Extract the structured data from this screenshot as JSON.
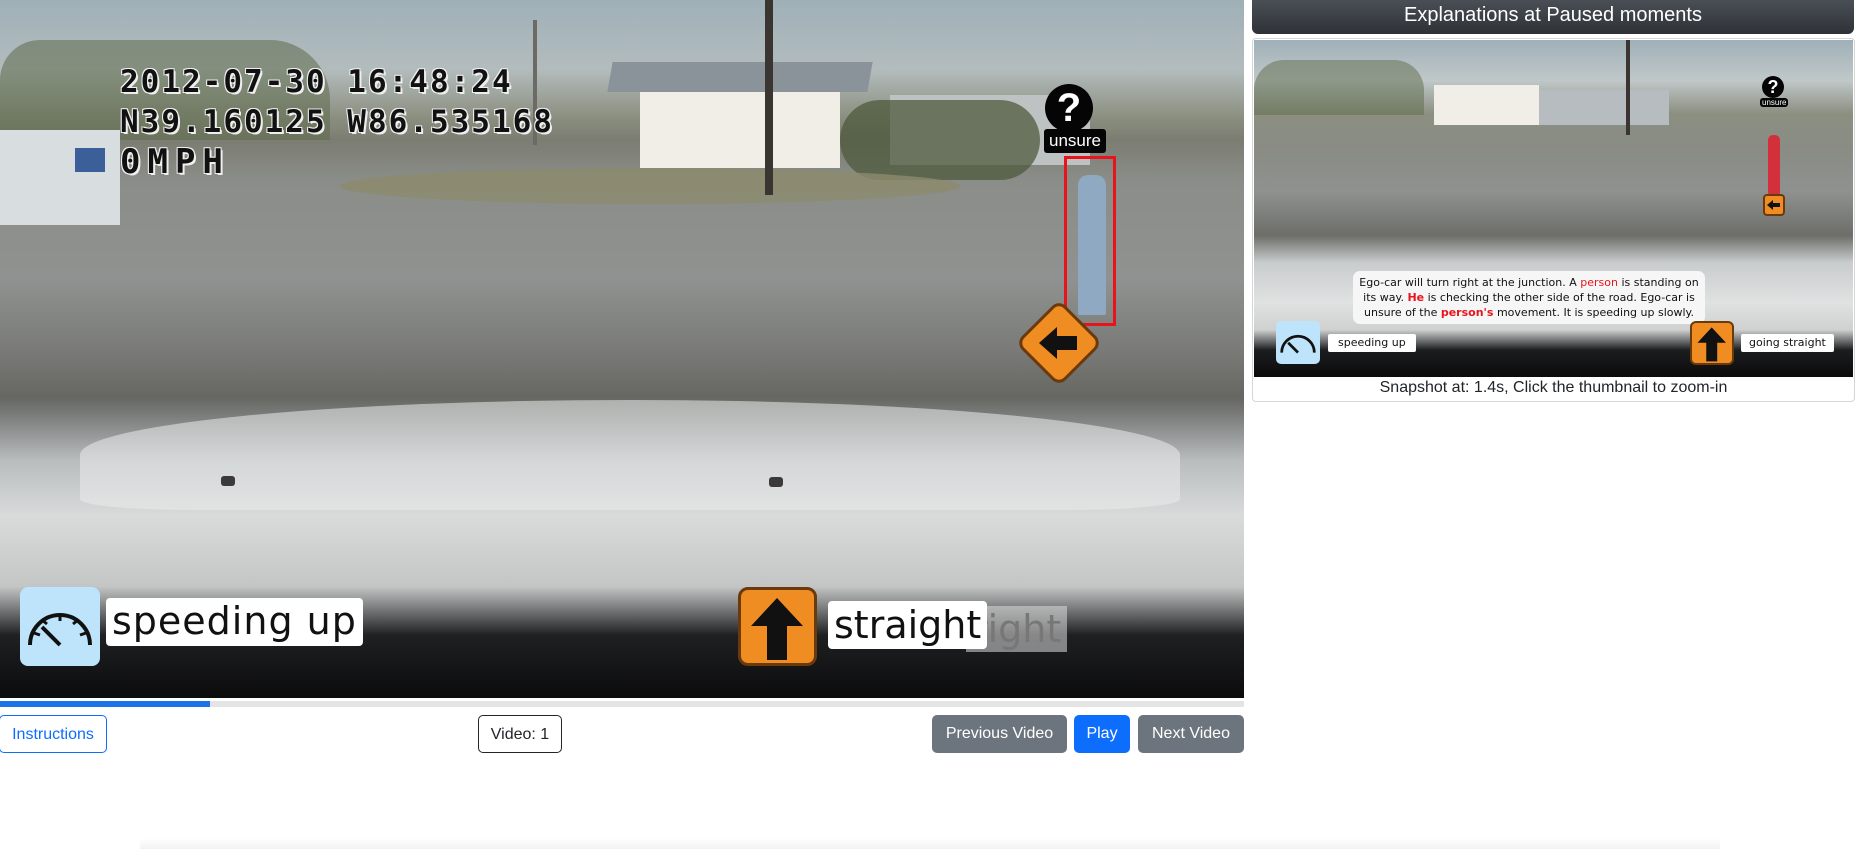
{
  "video": {
    "overlay_date": "2012-07-30  16:48:24",
    "overlay_gps": "N39.160125  W86.535168",
    "overlay_speed": "0MPH",
    "object_tag": "unsure",
    "question_mark": "?",
    "speed_action": "speeding up",
    "direction_action": "straight",
    "direction_ghost": "right",
    "progress": 0.169
  },
  "controls": {
    "instructions": "Instructions",
    "video_counter": "Video: 1",
    "previous": "Previous Video",
    "play": "Play",
    "next": "Next Video"
  },
  "panel": {
    "header": "Explanations at Paused moments",
    "thumb": {
      "object_tag": "unsure",
      "question_mark": "?",
      "explanation": {
        "p1": "Ego-car will turn right at the junction. A ",
        "w1": "person",
        "p2": " is standing on its way. ",
        "w2": "He",
        "p3": " is checking the other side of the road. Ego-car is unsure of the ",
        "w3": "person's",
        "p4": " movement. It is speeding up slowly."
      },
      "speed_action": "speeding up",
      "direction_action": "going straight"
    },
    "caption": "Snapshot at: 1.4s, Click the thumbnail to zoom-in"
  },
  "colors": {
    "accent_blue": "#0d6efd",
    "highlight_red": "#e8141c",
    "sign_orange": "#ef8c22",
    "speed_icon_bg": "#bde4fa"
  }
}
